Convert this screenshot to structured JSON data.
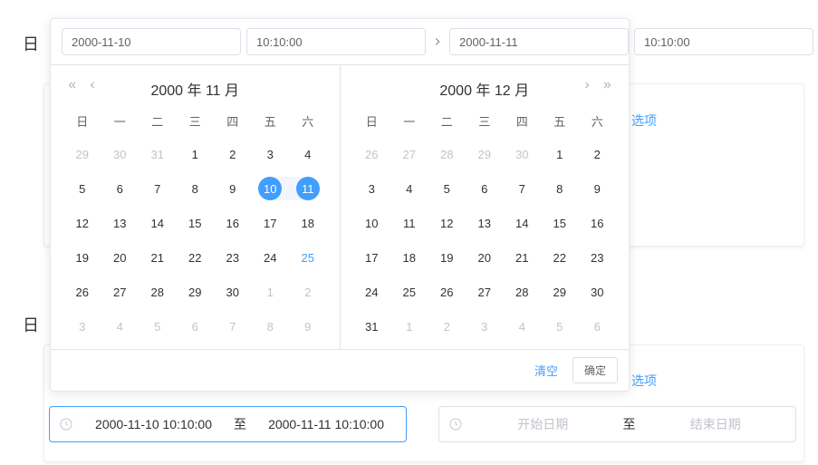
{
  "bg": {
    "label_top": "日",
    "label_bottom": "日",
    "option_text": "选项"
  },
  "popup": {
    "start_date": "2000-11-10",
    "start_time": "10:10:00",
    "end_date": "2000-11-11",
    "end_time": "10:10:00",
    "clear_label": "清空",
    "confirm_label": "确定",
    "dow": [
      "日",
      "一",
      "二",
      "三",
      "四",
      "五",
      "六"
    ],
    "left": {
      "title": "2000 年 11 月",
      "weeks": [
        [
          {
            "n": 29,
            "other": true
          },
          {
            "n": 30,
            "other": true
          },
          {
            "n": 31,
            "other": true
          },
          {
            "n": 1
          },
          {
            "n": 2
          },
          {
            "n": 3
          },
          {
            "n": 4
          }
        ],
        [
          {
            "n": 5
          },
          {
            "n": 6
          },
          {
            "n": 7
          },
          {
            "n": 8
          },
          {
            "n": 9
          },
          {
            "n": 10,
            "sel": "start"
          },
          {
            "n": 11,
            "sel": "end"
          }
        ],
        [
          {
            "n": 12
          },
          {
            "n": 13
          },
          {
            "n": 14
          },
          {
            "n": 15
          },
          {
            "n": 16
          },
          {
            "n": 17
          },
          {
            "n": 18
          }
        ],
        [
          {
            "n": 19
          },
          {
            "n": 20
          },
          {
            "n": 21
          },
          {
            "n": 22
          },
          {
            "n": 23
          },
          {
            "n": 24
          },
          {
            "n": 25,
            "today": true
          }
        ],
        [
          {
            "n": 26
          },
          {
            "n": 27
          },
          {
            "n": 28
          },
          {
            "n": 29
          },
          {
            "n": 30
          },
          {
            "n": 1,
            "other": true
          },
          {
            "n": 2,
            "other": true
          }
        ],
        [
          {
            "n": 3,
            "other": true
          },
          {
            "n": 4,
            "other": true
          },
          {
            "n": 5,
            "other": true
          },
          {
            "n": 6,
            "other": true
          },
          {
            "n": 7,
            "other": true
          },
          {
            "n": 8,
            "other": true
          },
          {
            "n": 9,
            "other": true
          }
        ]
      ]
    },
    "right": {
      "title": "2000 年 12 月",
      "weeks": [
        [
          {
            "n": 26,
            "other": true
          },
          {
            "n": 27,
            "other": true
          },
          {
            "n": 28,
            "other": true
          },
          {
            "n": 29,
            "other": true
          },
          {
            "n": 30,
            "other": true
          },
          {
            "n": 1
          },
          {
            "n": 2
          }
        ],
        [
          {
            "n": 3
          },
          {
            "n": 4
          },
          {
            "n": 5
          },
          {
            "n": 6
          },
          {
            "n": 7
          },
          {
            "n": 8
          },
          {
            "n": 9
          }
        ],
        [
          {
            "n": 10
          },
          {
            "n": 11
          },
          {
            "n": 12
          },
          {
            "n": 13
          },
          {
            "n": 14
          },
          {
            "n": 15
          },
          {
            "n": 16
          }
        ],
        [
          {
            "n": 17
          },
          {
            "n": 18
          },
          {
            "n": 19
          },
          {
            "n": 20
          },
          {
            "n": 21
          },
          {
            "n": 22
          },
          {
            "n": 23
          }
        ],
        [
          {
            "n": 24
          },
          {
            "n": 25
          },
          {
            "n": 26
          },
          {
            "n": 27
          },
          {
            "n": 28
          },
          {
            "n": 29
          },
          {
            "n": 30
          }
        ],
        [
          {
            "n": 31
          },
          {
            "n": 1,
            "other": true
          },
          {
            "n": 2,
            "other": true
          },
          {
            "n": 3,
            "other": true
          },
          {
            "n": 4,
            "other": true
          },
          {
            "n": 5,
            "other": true
          },
          {
            "n": 6,
            "other": true
          }
        ]
      ]
    }
  },
  "bottom": {
    "left": {
      "start": "2000-11-10 10:10:00",
      "end": "2000-11-11 10:10:00",
      "sep": "至"
    },
    "right": {
      "start_placeholder": "开始日期",
      "end_placeholder": "结束日期",
      "sep": "至"
    }
  }
}
